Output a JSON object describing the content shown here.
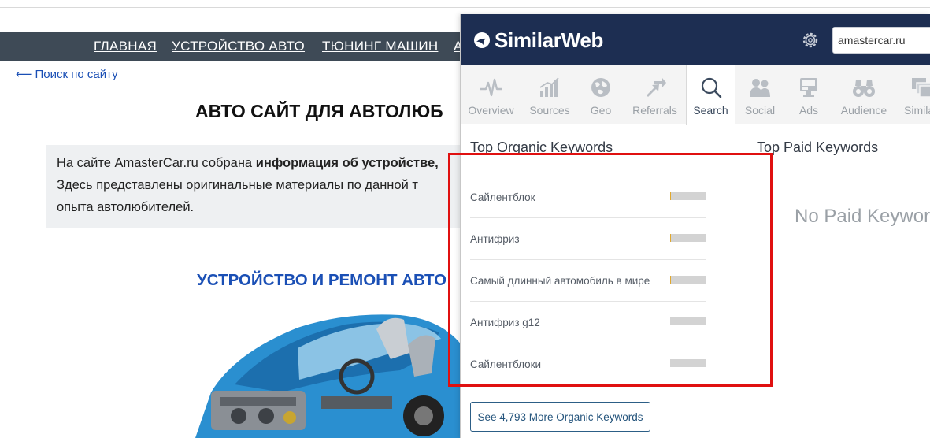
{
  "site": {
    "nav": [
      "ГЛАВНАЯ",
      "УСТРОЙСТВО АВТО",
      "ТЮНИНГ МАШИН",
      "А"
    ],
    "search_link": "Поиск по сайту",
    "title": "АВТО САЙТ ДЛЯ АВТОЛЮБ",
    "intro_line1_prefix": "На сайте AmasterCar.ru собрана ",
    "intro_line1_bold": "информация об устройстве,",
    "intro_line2": "Здесь представлены оригинальные материалы по данной т",
    "intro_line3": "опыта автолюбителей.",
    "subtitle": "УСТРОЙСТВО И РЕМОНТ АВТО"
  },
  "similarweb": {
    "logo_text": "SimilarWeb",
    "domain_value": "amastercar.ru",
    "tabs": [
      {
        "label": "Overview",
        "icon": "pulse-icon",
        "active": false
      },
      {
        "label": "Sources",
        "icon": "bar-chart-icon",
        "active": false
      },
      {
        "label": "Geo",
        "icon": "globe-icon",
        "active": false
      },
      {
        "label": "Referrals",
        "icon": "arrows-icon",
        "active": false
      },
      {
        "label": "Search",
        "icon": "magnifier-icon",
        "active": true
      },
      {
        "label": "Social",
        "icon": "people-icon",
        "active": false
      },
      {
        "label": "Ads",
        "icon": "ads-icon",
        "active": false
      },
      {
        "label": "Audience",
        "icon": "binoculars-icon",
        "active": false
      },
      {
        "label": "Simila",
        "icon": "windows-icon",
        "active": false
      }
    ],
    "organic_title": "Top Organic Keywords",
    "paid_title": "Top Paid Keywords",
    "organic_keywords": [
      {
        "keyword": "Сайлентблок",
        "share": 0.03
      },
      {
        "keyword": "Антифриз",
        "share": 0.03
      },
      {
        "keyword": "Самый длинный автомобиль в мире",
        "share": 0.03
      },
      {
        "keyword": "Антифриз g12",
        "share": 0
      },
      {
        "keyword": "Сайлентблоки",
        "share": 0
      }
    ],
    "no_paid_text": "No Paid Keywor",
    "more_button": "See 4,793 More Organic Keywords"
  },
  "colors": {
    "header_bg": "#1d2e52",
    "highlight": "#e01010",
    "site_nav_bg": "#3e4a56",
    "link_blue": "#1a4fb5"
  }
}
